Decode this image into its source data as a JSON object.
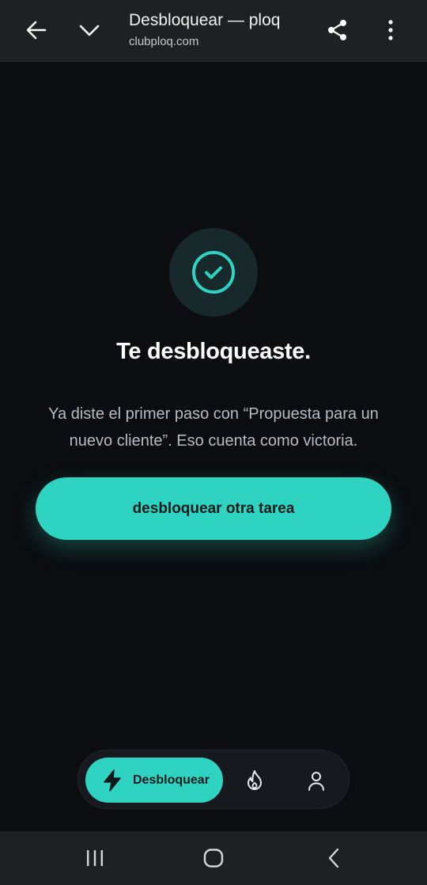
{
  "browser": {
    "title": "Desbloquear — ploq",
    "url": "clubploq.com"
  },
  "success": {
    "headline": "Te desbloqueaste.",
    "message": "Ya diste el primer paso con “Propuesta para un nuevo cliente”. Eso cuenta como victoria.",
    "cta_label": "desbloquear otra tarea"
  },
  "bottom_nav": {
    "items": [
      {
        "label": "Desbloquear",
        "icon": "bolt-icon",
        "active": true
      },
      {
        "label": "",
        "icon": "flame-icon",
        "active": false
      },
      {
        "label": "",
        "icon": "user-icon",
        "active": false
      }
    ]
  },
  "colors": {
    "accent": "#2ed3c2",
    "background": "#0b0d10",
    "topbar": "#1e2023"
  }
}
